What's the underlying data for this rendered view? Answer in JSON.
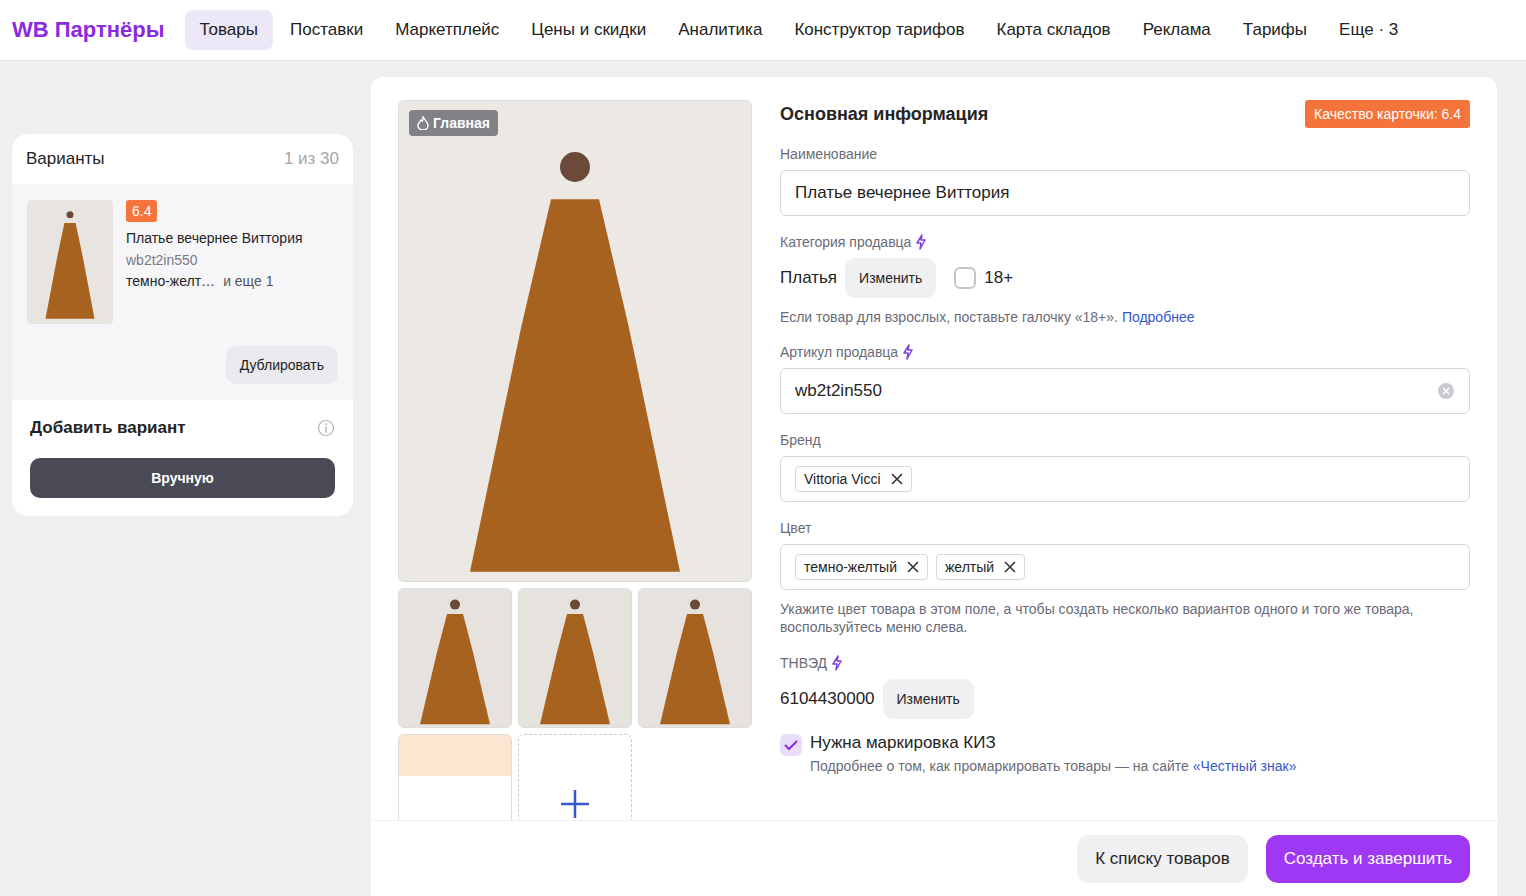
{
  "nav": {
    "logo": "WB Партнёры",
    "tabs": [
      {
        "label": "Товары",
        "selected": true
      },
      {
        "label": "Поставки",
        "selected": false
      },
      {
        "label": "Маркетплейс",
        "selected": false
      },
      {
        "label": "Цены и скидки",
        "selected": false
      },
      {
        "label": "Аналитика",
        "selected": false
      },
      {
        "label": "Конструктор тарифов",
        "selected": false
      },
      {
        "label": "Карта складов",
        "selected": false
      },
      {
        "label": "Реклама",
        "selected": false
      },
      {
        "label": "Тарифы",
        "selected": false
      },
      {
        "label": "Еще · 3",
        "selected": false
      }
    ]
  },
  "variants": {
    "title": "Варианты",
    "count": "1 из 30",
    "items": [
      {
        "badge": "6.4",
        "name": "Платье вечернее Виттория",
        "article": "wb2t2in550",
        "color": "темно-желт…",
        "more": "и еще 1",
        "selected": true
      }
    ],
    "duplicate": "Дублировать"
  },
  "add_variant": {
    "title": "Добавить вариант",
    "button": "Вручную"
  },
  "photos": {
    "main_badge": "Главная"
  },
  "form": {
    "title": "Основная информация",
    "quality": "Качество карточки: 6.4",
    "name_label": "Наименование",
    "name_value": "Платье вечернее Виттория",
    "category_label": "Категория продавца",
    "category": "Платья",
    "category_change": "Изменить",
    "adult": {
      "label": "18+",
      "checked": false
    },
    "adult_hint": "Если товар для взрослых, поставьте галочку «18+».",
    "adult_link": "Подробнее",
    "article_label": "Артикул продавца",
    "article_value": "wb2t2in550",
    "brand_label": "Бренд",
    "brands": [
      "Vittoria Vicci"
    ],
    "color_label": "Цвет",
    "colors": [
      "темно-желтый",
      "желтый"
    ],
    "color_hint": "Укажите цвет товара в этом поле, а чтобы создать несколько вариантов одного и того же товара, воспользуйтесь меню слева.",
    "tnved_label": "ТНВЭД",
    "tnved": "6104430000",
    "tnved_change": "Изменить",
    "kiz": {
      "label": "Нужна маркировка КИЗ",
      "checked": true
    },
    "kiz_hint": "Подробнее о том, как промаркировать товары — на сайте",
    "kiz_link": "«Честный знак»"
  },
  "footer": {
    "back": "К списку товаров",
    "submit": "Создать и завершить"
  }
}
